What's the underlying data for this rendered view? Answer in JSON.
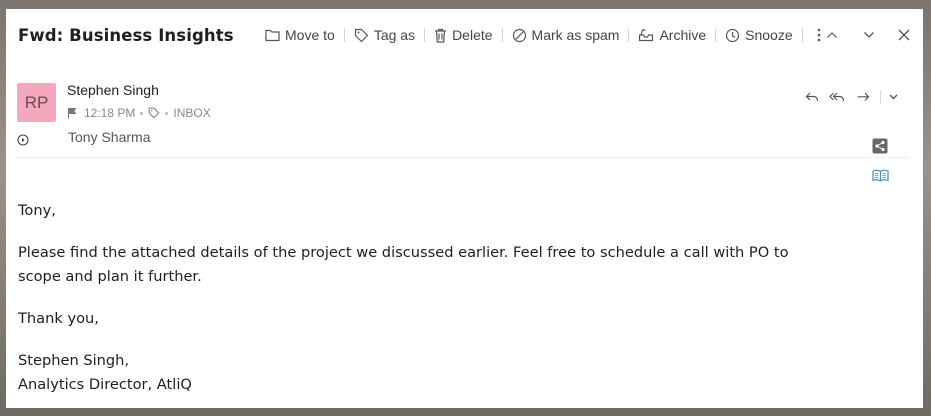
{
  "email": {
    "subject": "Fwd: Business Insights",
    "sender_name": "Stephen Singh",
    "avatar_initials": "RP",
    "time": "12:18 PM",
    "folder": "INBOX",
    "recipient": "Tony Sharma"
  },
  "toolbar": {
    "move_to": "Move to",
    "tag_as": "Tag as",
    "delete": "Delete",
    "mark_spam": "Mark as spam",
    "archive": "Archive",
    "snooze": "Snooze"
  },
  "body": {
    "greeting": "Tony,",
    "paragraph1_line1": "Please find the attached details of the project we discussed earlier. Feel free to schedule a call with PO to",
    "paragraph1_line2": "scope and plan it further.",
    "closing": "Thank you,",
    "signature_name": "Stephen Singh,",
    "signature_title": "Analytics Director, AtliQ"
  },
  "icons": {
    "move_to": "folder-icon",
    "tag_as": "tag-icon",
    "delete": "trash-icon",
    "mark_spam": "block-icon",
    "archive": "archive-icon",
    "snooze": "clock-icon",
    "more": "more-vertical-icon",
    "prev": "chevron-up-icon",
    "next": "chevron-down-icon",
    "close": "close-icon",
    "reply": "reply-icon",
    "reply_all": "reply-all-icon",
    "forward": "forward-icon",
    "share": "share-icon",
    "reader": "book-icon",
    "flag": "flag-icon"
  },
  "colors": {
    "avatar_bg": "#f4a7bd",
    "reader_icon": "#4a8ec2"
  }
}
